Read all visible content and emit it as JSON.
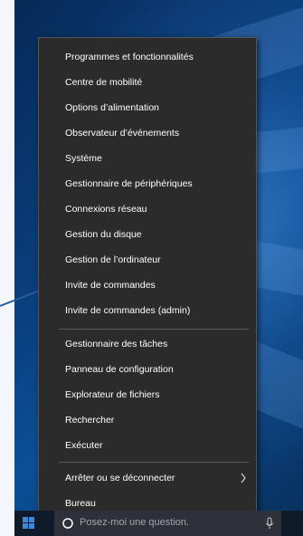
{
  "context_menu": {
    "items": [
      {
        "label": "Programmes et fonctionnalités"
      },
      {
        "label": "Centre de mobilité"
      },
      {
        "label": "Options d’alimentation"
      },
      {
        "label": "Observateur d’événements"
      },
      {
        "label": "Système"
      },
      {
        "label": "Gestionnaire de périphériques"
      },
      {
        "label": "Connexions réseau"
      },
      {
        "label": "Gestion du disque"
      },
      {
        "label": "Gestion de l’ordinateur"
      },
      {
        "label": "Invite de commandes"
      },
      {
        "label": "Invite de commandes (admin)"
      },
      {
        "label": "Gestionnaire des tâches"
      },
      {
        "label": "Panneau de configuration"
      },
      {
        "label": "Explorateur de fichiers"
      },
      {
        "label": "Rechercher"
      },
      {
        "label": "Exécuter"
      },
      {
        "label": "Arrêter ou se déconnecter",
        "submenu_icon": "chevron-right-icon"
      },
      {
        "label": "Bureau"
      }
    ]
  },
  "taskbar": {
    "search_placeholder": "Posez-moi une question.",
    "start_icon": "windows-logo-icon",
    "mic_icon": "microphone-icon"
  },
  "colors": {
    "menu_bg": "#2b2b2b",
    "menu_text": "#ffffff",
    "separator": "#5a5a5a",
    "taskbar_bg": "#0f1a2a",
    "accent_blue": "#3b8ad9"
  }
}
